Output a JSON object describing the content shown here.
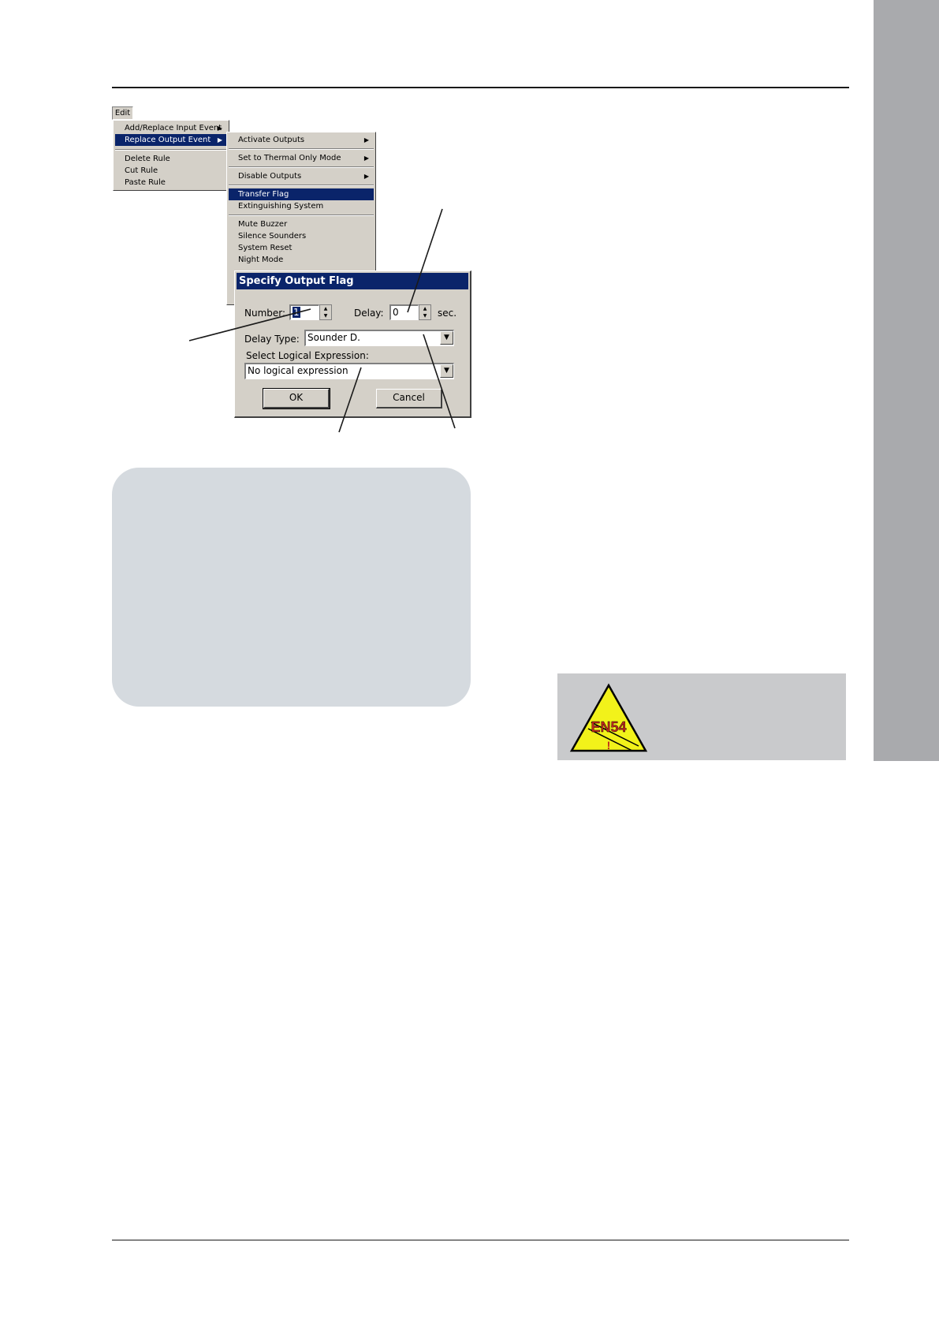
{
  "edit_menu": {
    "title": "Edit",
    "items": [
      {
        "label": "Add/Replace Input Event",
        "has_submenu": true
      },
      {
        "label": "Replace Output Event",
        "has_submenu": true,
        "selected": true
      },
      {
        "label": "Delete Rule"
      },
      {
        "label": "Cut Rule"
      },
      {
        "label": "Paste Rule"
      }
    ]
  },
  "output_submenu": {
    "items": [
      {
        "label": "Activate Outputs",
        "has_submenu": true
      },
      {
        "label": "Set to Thermal Only Mode",
        "has_submenu": true
      },
      {
        "label": "Disable Outputs",
        "has_submenu": true
      },
      {
        "label": "Transfer Flag",
        "selected": true
      },
      {
        "label": "Extinguishing System"
      },
      {
        "label": "Mute Buzzer"
      },
      {
        "label": "Silence Sounders"
      },
      {
        "label": "System Reset"
      },
      {
        "label": "Night Mode"
      }
    ]
  },
  "dialog": {
    "title": "Specify Output Flag",
    "number_label": "Number:",
    "number_value": "1",
    "delay_label": "Delay:",
    "delay_value": "0",
    "delay_unit": "sec.",
    "delay_type_label": "Delay Type:",
    "delay_type_value": "Sounder D.",
    "logical_label": "Select Logical Expression:",
    "logical_value": "No logical expression",
    "ok_label": "OK",
    "cancel_label": "Cancel"
  },
  "warning_badge": {
    "text": "EN54",
    "mark": "!",
    "colors": {
      "fill": "#f2f21a",
      "text": "#c0281e",
      "outline": "#000000"
    }
  },
  "colors": {
    "side_tab": "#a9aaad",
    "note_box": "#d5dadf",
    "en54_box": "#c9cacc",
    "menu_highlight": "#0a246a"
  }
}
